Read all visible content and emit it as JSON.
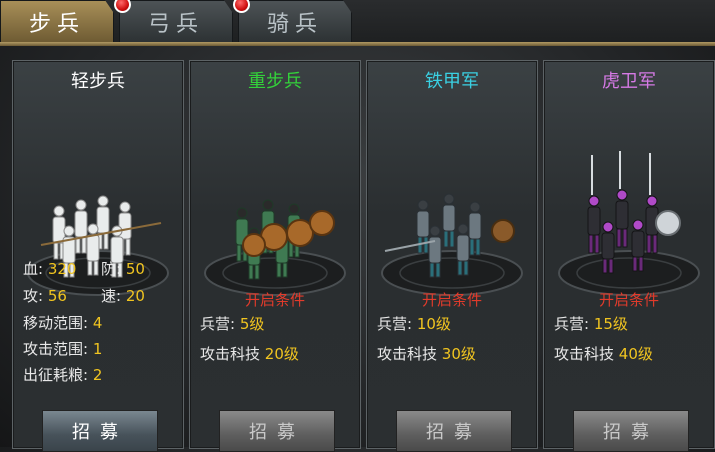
{
  "tabs": [
    {
      "label": "步兵",
      "active": true
    },
    {
      "label": "弓兵",
      "active": false
    },
    {
      "label": "骑兵",
      "active": false
    }
  ],
  "units": [
    {
      "name": "轻步兵",
      "name_color": "#ffffff",
      "stats": {
        "hp_label": "血:",
        "hp": "320",
        "def_label": "防:",
        "def": "50",
        "atk_label": "攻:",
        "atk": "56",
        "spd_label": "速:",
        "spd": "20",
        "move_label": "移动范围:",
        "move": "4",
        "range_label": "攻击范围:",
        "range": "1",
        "food_label": "出征耗粮:",
        "food": "2"
      },
      "button": "招募",
      "button_enabled": true
    },
    {
      "name": "重步兵",
      "name_color": "#33d23a",
      "unlock_title": "开启条件",
      "req1_label": "兵营:",
      "req1_value": "5级",
      "req2_label": "攻击科技",
      "req2_value": "20级",
      "button": "招募",
      "button_enabled": false
    },
    {
      "name": "铁甲军",
      "name_color": "#3ad0e2",
      "unlock_title": "开启条件",
      "req1_label": "兵营:",
      "req1_value": "10级",
      "req2_label": "攻击科技",
      "req2_value": "30级",
      "button": "招募",
      "button_enabled": false
    },
    {
      "name": "虎卫军",
      "name_color": "#d67ae6",
      "unlock_title": "开启条件",
      "req1_label": "兵营:",
      "req1_value": "15级",
      "req2_label": "攻击科技",
      "req2_value": "40级",
      "button": "招募",
      "button_enabled": false
    }
  ],
  "colors": {
    "accent_gold": "#b29a64",
    "stat_value": "#f0c420",
    "unlock_red": "#e23b2b",
    "badge_red": "#d01010"
  }
}
